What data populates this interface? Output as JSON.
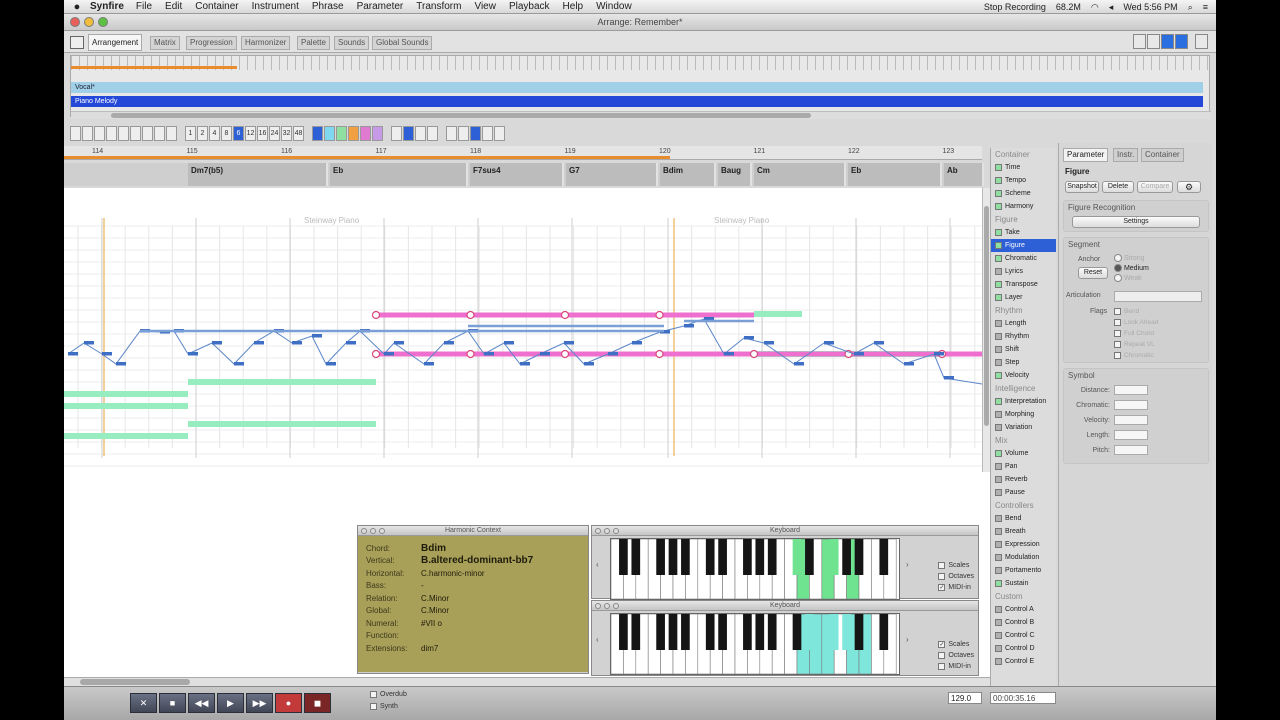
{
  "menubar": {
    "app": "Synfire",
    "items": [
      "File",
      "Edit",
      "Container",
      "Instrument",
      "Phrase",
      "Parameter",
      "Transform",
      "View",
      "Playback",
      "Help",
      "Window"
    ],
    "stop_recording": "Stop Recording",
    "battery": "68.2M",
    "clock": "Wed 5:56 PM"
  },
  "window": {
    "title": "Arrange: Remember*"
  },
  "tabs": [
    "Arrangement",
    "Matrix",
    "Progression",
    "Harmonizer",
    "Palette",
    "Sounds",
    "Global Sounds"
  ],
  "overview": {
    "tracks": [
      {
        "name": "Vocal*",
        "color": "#9fd0e8"
      },
      {
        "name": "Piano Melody",
        "color": "#2448d8"
      }
    ]
  },
  "toolbar": {
    "resolutions": [
      "1",
      "2",
      "4",
      "8",
      "6",
      "12",
      "16",
      "24",
      "32",
      "48"
    ],
    "selected_resolution": "6",
    "colors": [
      "#2d5fd6",
      "#7fd8ef",
      "#8fe0a0",
      "#f0a040",
      "#e07ad0",
      "#c79ae8"
    ]
  },
  "ruler": {
    "ticks": [
      "114",
      "115",
      "116",
      "117",
      "118",
      "119",
      "120",
      "121",
      "122",
      "123"
    ]
  },
  "chords": [
    "Dm7(b5)",
    "Eb",
    "F7sus4",
    "G7",
    "Bdim",
    "Baug",
    "Cm",
    "Eb",
    "Ab"
  ],
  "roll": {
    "instrument_labels": [
      "Steinway Piano",
      "Steinway Piano"
    ]
  },
  "harmony_context": {
    "title": "Harmonic Context",
    "rows": [
      {
        "label": "Chord:",
        "value": "Bdim",
        "big": true
      },
      {
        "label": "Vertical:",
        "value": "B.altered-dominant-bb7",
        "big": true
      },
      {
        "label": "Horizontal:",
        "value": "C.harmonic-minor"
      },
      {
        "label": "Bass:",
        "value": "-"
      },
      {
        "label": "Relation:",
        "value": "C.Minor"
      },
      {
        "label": "Global:",
        "value": "C.Minor"
      },
      {
        "label": "Numeral:",
        "value": "#VII o"
      },
      {
        "label": "Function:",
        "value": ""
      },
      {
        "label": "Extensions:",
        "value": "dim7"
      }
    ]
  },
  "keyboards": [
    {
      "title": "Keyboard",
      "options": [
        "Scales",
        "Octaves",
        "MIDI-in"
      ],
      "checked": [
        false,
        false,
        true
      ],
      "highlight": "#6fe38f"
    },
    {
      "title": "Keyboard",
      "options": [
        "Scales",
        "Octaves",
        "MIDI-in"
      ],
      "checked": [
        true,
        false,
        false
      ],
      "highlight": "#7fe6dc"
    }
  ],
  "transport": {
    "buttons": [
      "✕",
      "■",
      "◀◀",
      "▶",
      "▶▶",
      "●",
      "◼"
    ],
    "options": [
      "Overdub",
      "Synth"
    ],
    "tempo": "129.0",
    "timecode": "00:00:35.16"
  },
  "categories": [
    {
      "head": "Container"
    },
    {
      "name": "Time",
      "color": "#8fe0a0"
    },
    {
      "name": "Tempo",
      "color": "#8fe0a0"
    },
    {
      "name": "Scheme",
      "color": "#8fe0a0"
    },
    {
      "name": "Harmony",
      "color": "#8fe0a0"
    },
    {
      "head": "Figure"
    },
    {
      "name": "Take",
      "color": "#8fe0a0"
    },
    {
      "name": "Figure",
      "color": "#8fe0a0",
      "selected": true
    },
    {
      "name": "Chromatic",
      "color": "#8fe0a0"
    },
    {
      "name": "Lyrics",
      "color": "#b0b0b0"
    },
    {
      "name": "Transpose",
      "color": "#8fe0a0"
    },
    {
      "name": "Layer",
      "color": "#8fe0a0"
    },
    {
      "head": "Rhythm"
    },
    {
      "name": "Length",
      "color": "#b0b0b0"
    },
    {
      "name": "Rhythm",
      "color": "#b0b0b0"
    },
    {
      "name": "Shift",
      "color": "#b0b0b0"
    },
    {
      "name": "Step",
      "color": "#b0b0b0"
    },
    {
      "name": "Velocity",
      "color": "#8fe0a0"
    },
    {
      "head": "Intelligence"
    },
    {
      "name": "Interpretation",
      "color": "#8fe0a0"
    },
    {
      "name": "Morphing",
      "color": "#b0b0b0"
    },
    {
      "name": "Variation",
      "color": "#b0b0b0"
    },
    {
      "head": "Mix"
    },
    {
      "name": "Volume",
      "color": "#8fe0a0"
    },
    {
      "name": "Pan",
      "color": "#b0b0b0"
    },
    {
      "name": "Reverb",
      "color": "#b0b0b0"
    },
    {
      "name": "Pause",
      "color": "#b0b0b0"
    },
    {
      "head": "Controllers"
    },
    {
      "name": "Bend",
      "color": "#b0b0b0"
    },
    {
      "name": "Breath",
      "color": "#b0b0b0"
    },
    {
      "name": "Expression",
      "color": "#b0b0b0"
    },
    {
      "name": "Modulation",
      "color": "#b0b0b0"
    },
    {
      "name": "Portamento",
      "color": "#b0b0b0"
    },
    {
      "name": "Sustain",
      "color": "#8fe0a0"
    },
    {
      "head": "Custom"
    },
    {
      "name": "Control A",
      "color": "#b0b0b0"
    },
    {
      "name": "Control B",
      "color": "#b0b0b0"
    },
    {
      "name": "Control C",
      "color": "#b0b0b0"
    },
    {
      "name": "Control D",
      "color": "#b0b0b0"
    },
    {
      "name": "Control E",
      "color": "#b0b0b0"
    }
  ],
  "inspector": {
    "tabs": [
      "Parameter",
      "Instr.",
      "Container"
    ],
    "section": "Figure",
    "buttons": [
      "Snapshot",
      "Delete",
      "Compare"
    ],
    "figure_recognition": {
      "label": "Figure Recognition",
      "settings": "Settings"
    },
    "segment": {
      "label": "Segment",
      "anchor_label": "Anchor",
      "anchor_options": [
        "Strong",
        "Medium",
        "Weak"
      ],
      "reset": "Reset",
      "articulation": "Articulation",
      "flags_label": "Flags",
      "flags": [
        "Bend",
        "Look Ahead",
        "Full Chord",
        "Repeat VL",
        "Chromatic"
      ]
    },
    "symbol": {
      "label": "Symbol",
      "fields": [
        "Distance:",
        "Chromatic:",
        "Velocity:",
        "Length:",
        "Pitch:"
      ]
    }
  }
}
